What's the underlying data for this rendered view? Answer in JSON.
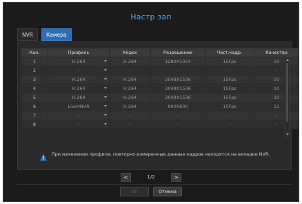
{
  "dialog": {
    "title": "Настр зап",
    "tabs": [
      {
        "label": "NVR",
        "active": false
      },
      {
        "label": "Камера",
        "active": true
      }
    ]
  },
  "table": {
    "headers": [
      "Кан.",
      "Профиль",
      "Кодек",
      "Разрешение",
      "Част.кадр.",
      "Качество"
    ],
    "rows": [
      {
        "ch": "1",
        "profile": "H.264",
        "codec": "H.264",
        "resolution": "1280X1024",
        "fps": "15Fps",
        "quality": "10"
      },
      {
        "ch": "2",
        "profile": "--",
        "codec": "--",
        "resolution": "--",
        "fps": "--",
        "quality": "--"
      },
      {
        "ch": "3",
        "profile": "H.264",
        "codec": "H.264",
        "resolution": "2048X1536",
        "fps": "15Fps",
        "quality": "10"
      },
      {
        "ch": "4",
        "profile": "H.264",
        "codec": "H.264",
        "resolution": "2048X1536",
        "fps": "15Fps",
        "quality": "10"
      },
      {
        "ch": "5",
        "profile": "H.264",
        "codec": "H.264",
        "resolution": "2048X1536",
        "fps": "15Fps",
        "quality": "10"
      },
      {
        "ch": "6",
        "profile": "Live4NVR",
        "codec": "H.264",
        "resolution": "800X600",
        "fps": "15Fps",
        "quality": "11"
      },
      {
        "ch": "7",
        "profile": "--",
        "codec": "--",
        "resolution": "--",
        "fps": "--",
        "quality": "--"
      },
      {
        "ch": "8",
        "profile": "--",
        "codec": "--",
        "resolution": "--",
        "fps": "--",
        "quality": "--"
      }
    ]
  },
  "notice": {
    "icon": "warning-icon",
    "text": "При изменении профиля, повторно измеренные данные кадров находятся на вкладке NVR."
  },
  "pager": {
    "prev": "<",
    "next": ">",
    "indicator": "1/2"
  },
  "buttons": {
    "ok": "OK",
    "cancel": "Отмена"
  },
  "colors": {
    "accent": "#2f6db5",
    "title": "#5aa8f0",
    "warning": "#2f6db5"
  }
}
